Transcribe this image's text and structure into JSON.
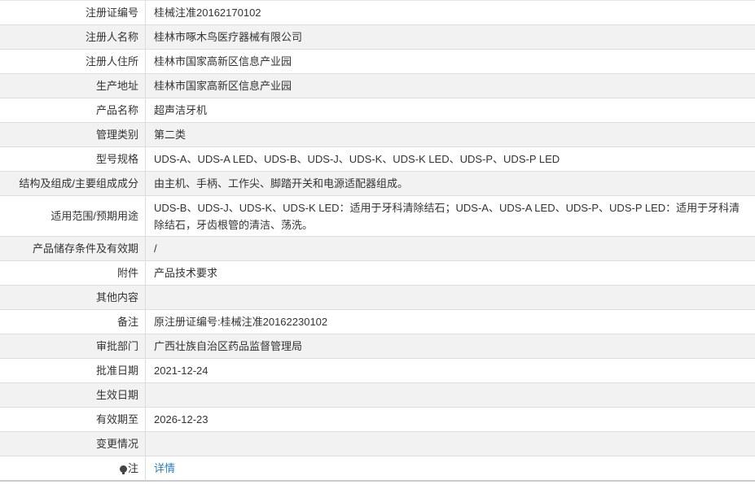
{
  "rows": [
    {
      "label": "注册证编号",
      "value": "桂械注准20162170102"
    },
    {
      "label": "注册人名称",
      "value": "桂林市啄木鸟医疗器械有限公司"
    },
    {
      "label": "注册人住所",
      "value": "桂林市国家高新区信息产业园"
    },
    {
      "label": "生产地址",
      "value": "桂林市国家高新区信息产业园"
    },
    {
      "label": "产品名称",
      "value": "超声洁牙机"
    },
    {
      "label": "管理类别",
      "value": "第二类"
    },
    {
      "label": "型号规格",
      "value": "UDS-A、UDS-A LED、UDS-B、UDS-J、UDS-K、UDS-K LED、UDS-P、UDS-P LED"
    },
    {
      "label": "结构及组成/主要组成成分",
      "value": "由主机、手柄、工作尖、脚踏开关和电源适配器组成。"
    },
    {
      "label": "适用范围/预期用途",
      "value": "UDS-B、UDS-J、UDS-K、UDS-K LED：适用于牙科清除结石；UDS-A、UDS-A LED、UDS-P、UDS-P LED：适用于牙科清除结石，牙齿根管的清洁、荡洗。"
    },
    {
      "label": "产品储存条件及有效期",
      "value": "/"
    },
    {
      "label": "附件",
      "value": "产品技术要求"
    },
    {
      "label": "其他内容",
      "value": ""
    },
    {
      "label": "备注",
      "value": "原注册证编号:桂械注准20162230102"
    },
    {
      "label": "审批部门",
      "value": "广西壮族自治区药品监督管理局"
    },
    {
      "label": "批准日期",
      "value": "2021-12-24"
    },
    {
      "label": "生效日期",
      "value": ""
    },
    {
      "label": "有效期至",
      "value": "2026-12-23"
    },
    {
      "label": "变更情况",
      "value": ""
    }
  ],
  "note_row": {
    "icon": "lightbulb-icon",
    "label": "注",
    "link_text": "详情"
  },
  "colors": {
    "stripe": "#f2f2f2",
    "border": "#dddddd",
    "link": "#2a7dc1"
  }
}
